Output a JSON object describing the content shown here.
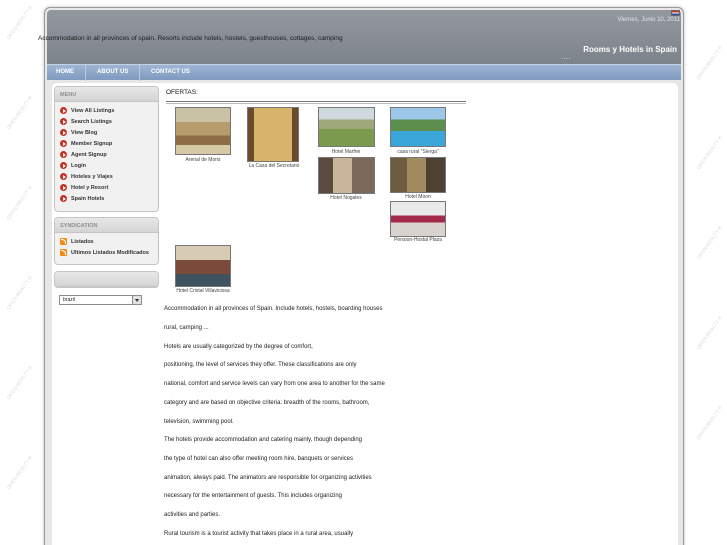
{
  "header": {
    "date": "Viernes, Junio 10, 2011",
    "tagline": "Accommodation in all provinces of spain. Resorts include hotels, hostels, guesthouses, cottages, camping",
    "site_title": "Rooms y Hotels in Spain",
    "dots": "....",
    "flag_icon": "uk-flag-icon"
  },
  "nav": [
    "HOME",
    "ABOUT US",
    "CONTACT US"
  ],
  "sidebar": {
    "menu_title": "MENU",
    "menu_items": [
      "View All Listings",
      "Search Listings",
      "View Blog",
      "Member Signup",
      "Agent Signup",
      "Login",
      "Hoteles y Viajes",
      "Hotel y Resort",
      "Spain Hotels"
    ],
    "syndication_title": "SYNDICATION",
    "syndication_items": [
      "Listados",
      "Ultimos Listados Modificados"
    ],
    "language_value": "brazil"
  },
  "offers": {
    "title": "OFERTAS:",
    "items": [
      "Arenal de Moris",
      "La Casa del Secretario",
      "Hotel Marfrei",
      "casa rural \"Sierga\"",
      "Hotel Nogales",
      "Hotel Moon",
      "Pension-Hostal Plaza",
      "Hotel Cristal Villaviciosa"
    ]
  },
  "body_lines": [
    "Accommodation in all provinces of Spain. Include hotels, hostels, boarding houses",
    "rural, camping ...",
    "Hotels are usually categorized by the degree of comfort,",
    "positioning, the level of services they offer. These classifications are only",
    "national, comfort and service levels can vary from one area to another for the same",
    "category and are based on objective criteria: breadth of the rooms, bathroom,",
    "television, swimming pool.",
    "The hotels provide accommodation and catering mainly, though depending",
    "the type of hotel can also offer meeting room hire, banquets or services",
    "animation, always paid. The animators are responsible for organizing activities",
    "necessary for the entertainment of guests. This includes organizing",
    "activities and parties.",
    "Rural tourism is a tourist activity that takes place in a rural area, usually"
  ],
  "watermark": "OPEN-REALTY ®"
}
